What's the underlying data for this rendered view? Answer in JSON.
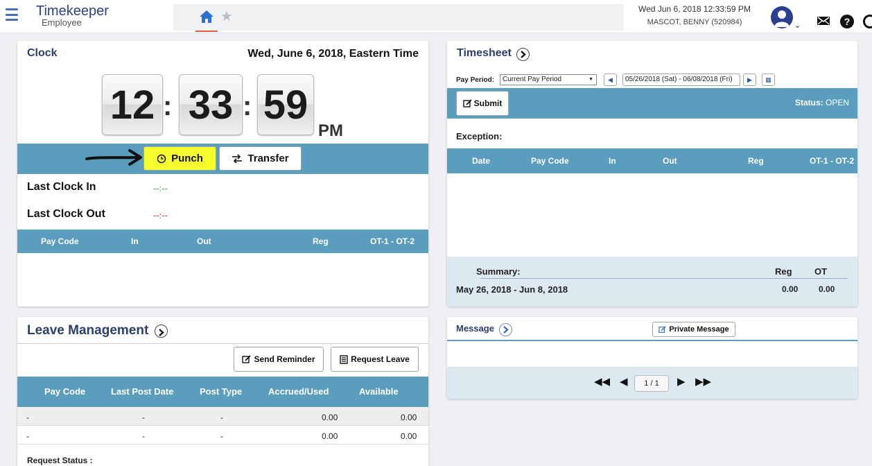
{
  "app": {
    "title": "Timekeeper",
    "subtitle": "Employee"
  },
  "header": {
    "datetime": "Wed Jun 6, 2018 12:33:59 PM",
    "user": "MASCOT, BENNY (520984)"
  },
  "clock": {
    "title": "Clock",
    "date": "Wed, June 6, 2018, Eastern Time",
    "hours": "12",
    "minutes": "33",
    "seconds": "59",
    "ampm": "PM",
    "punch_label": "Punch",
    "transfer_label": "Transfer",
    "last_in_label": "Last Clock In",
    "last_in_value": "--:--",
    "last_out_label": "Last Clock Out",
    "last_out_value": "--:--",
    "columns": [
      "Pay Code",
      "In",
      "Out",
      "Reg",
      "OT-1 - OT-2"
    ]
  },
  "timesheet": {
    "title": "Timesheet",
    "pay_period_label": "Pay Period:",
    "pay_period_value": "Current Pay Period",
    "range": "05/26/2018 (Sat) - 06/08/2018 (Fri)",
    "submit_label": "Submit",
    "status_label": "Status:",
    "status_value": "OPEN",
    "exception_label": "Exception:",
    "columns": [
      "Date",
      "Pay Code",
      "In",
      "Out",
      "Reg",
      "OT-1 - OT-2"
    ],
    "summary_label": "Summary:",
    "summary_reg_label": "Reg",
    "summary_ot_label": "OT",
    "summary_range": "May 26, 2018 - Jun 8, 2018",
    "summary_reg": "0.00",
    "summary_ot": "0.00"
  },
  "leave": {
    "title": "Leave Management",
    "send_reminder_label": "Send Reminder",
    "request_leave_label": "Request Leave",
    "columns": [
      "Pay Code",
      "Last Post Date",
      "Post Type",
      "Accrued/Used",
      "Available"
    ],
    "rows": [
      {
        "pay_code": "-",
        "last_post": "-",
        "post_type": "-",
        "accrued": "0.00",
        "available": "0.00"
      },
      {
        "pay_code": "-",
        "last_post": "-",
        "post_type": "-",
        "accrued": "0.00",
        "available": "0.00"
      }
    ],
    "request_status_label": "Request Status :"
  },
  "message": {
    "title": "Message",
    "private_label": "Private Message",
    "page": "1 / 1"
  },
  "colors": {
    "accent": "#5a9dbd",
    "brand": "#2b3f8c",
    "highlight": "#f6ff2e",
    "last_in": "#3aa93a",
    "last_out": "#d9461c"
  }
}
